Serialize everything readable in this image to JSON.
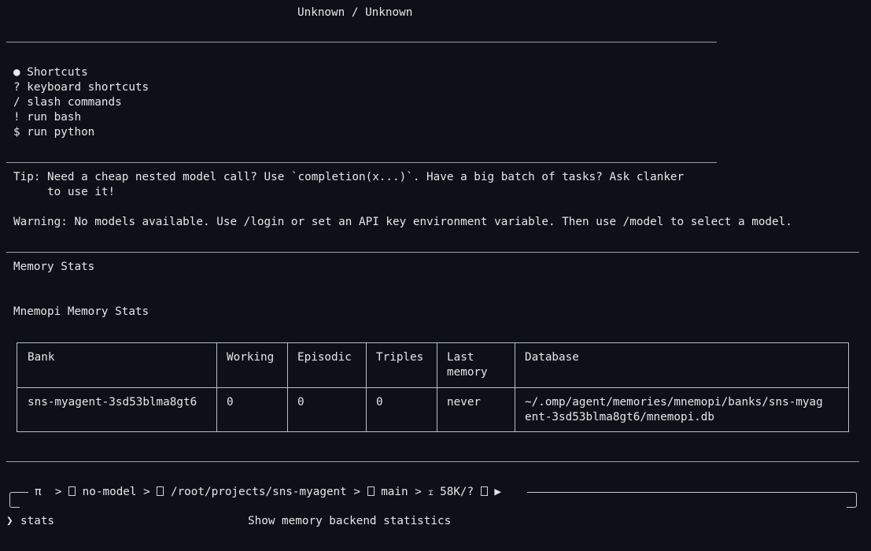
{
  "header": {
    "title": "Unknown / Unknown"
  },
  "shortcuts": {
    "heading": "● Shortcuts",
    "items": [
      "? keyboard shortcuts",
      "/ slash commands",
      "! run bash",
      "$ run python"
    ]
  },
  "tip": {
    "line1": "Tip: Need a cheap nested model call? Use `completion(x...)`. Have a big batch of tasks? Ask clanker",
    "line2": "     to use it!"
  },
  "warning": "Warning: No models available. Use /login or set an API key environment variable. Then use /model to select a model.",
  "memory": {
    "section_title": "Memory Stats",
    "table_title": "Mnemopi Memory Stats",
    "columns": {
      "bank": "Bank",
      "working": "Working",
      "episodic": "Episodic",
      "triples": "Triples",
      "last_memory_1": "Last",
      "last_memory_2": "memory",
      "database": "Database"
    },
    "rows": [
      {
        "bank": "sns-myagent-3sd53blma8gt6",
        "working": "0",
        "episodic": "0",
        "triples": "0",
        "last_memory": "never",
        "database_1": "~/.omp/agent/memories/mnemopi/banks/sns-myag",
        "database_2": "ent-3sd53blma8gt6/mnemopi.db"
      }
    ]
  },
  "status_bar": {
    "pi": "π",
    "sep": ">",
    "model": "no-model",
    "path": "/root/projects/sns-myagent",
    "branch": "main",
    "context": "58K/?",
    "arrow": "▶"
  },
  "prompt": {
    "chevron": "❯",
    "command": "stats",
    "description": "Show memory backend statistics"
  }
}
